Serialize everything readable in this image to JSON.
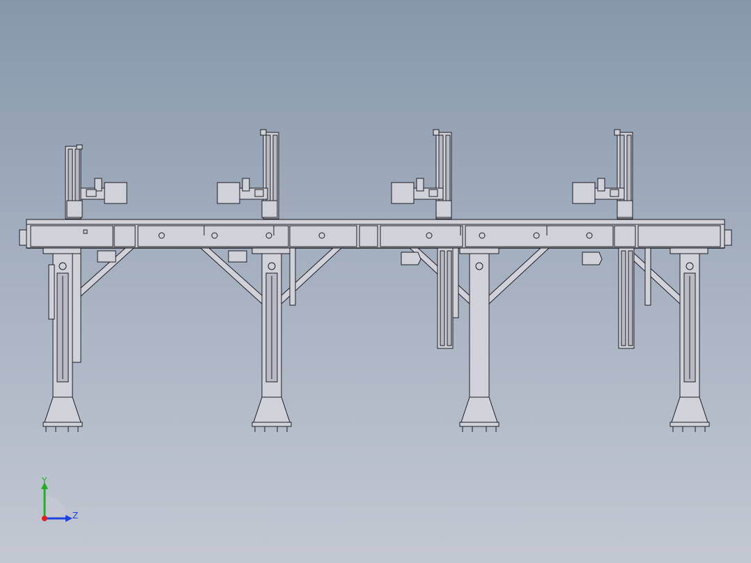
{
  "viewport": {
    "background_top": "#8797ab",
    "background_bottom": "#c3c8d2",
    "part_fill": "#d0d1d9",
    "edge_color": "#1e1e24"
  },
  "model": {
    "gantry_count": 4,
    "leg_count": 4
  },
  "triad": {
    "y_label": "Y",
    "z_label": "Z",
    "x_color": "#e02020",
    "y_color": "#20b020",
    "z_color": "#2040e0"
  }
}
